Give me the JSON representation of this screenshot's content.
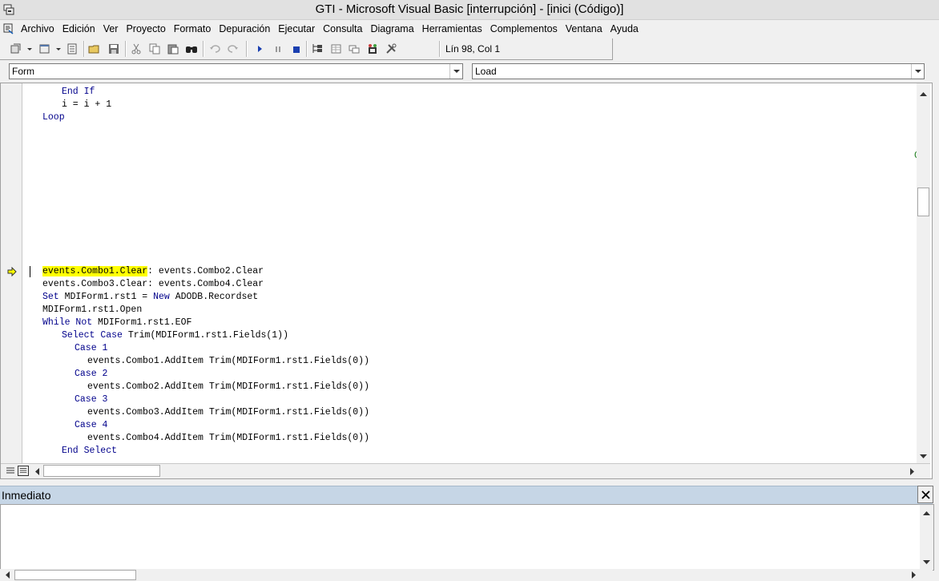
{
  "window": {
    "title": "GTI - Microsoft Visual Basic [interrupción] - [inici (Código)]"
  },
  "menubar": {
    "items": [
      "Archivo",
      "Edición",
      "Ver",
      "Proyecto",
      "Formato",
      "Depuración",
      "Ejecutar",
      "Consulta",
      "Diagrama",
      "Herramientas",
      "Complementos",
      "Ventana",
      "Ayuda"
    ]
  },
  "toolbar": {
    "status": "Lín 98, Col 1",
    "icons": [
      "add-project-icon",
      "add-form-icon",
      "menu-editor-icon",
      "open-icon",
      "save-icon",
      "cut-icon",
      "copy-icon",
      "paste-icon",
      "find-icon",
      "undo-icon",
      "redo-icon",
      "run-icon",
      "pause-icon",
      "stop-icon",
      "project-explorer-icon",
      "properties-icon",
      "form-layout-icon",
      "object-browser-icon",
      "toolbox-icon"
    ]
  },
  "combos": {
    "object": "Form",
    "procedure": "Load"
  },
  "code": {
    "lines_top": [
      "End If",
      "i = i + 1",
      "Loop"
    ],
    "current_line_highlight": "events.Combo1.Clear",
    "current_line_rest": ": events.Combo2.Clear",
    "lines_bottom": [
      "events.Combo3.Clear: events.Combo4.Clear",
      "Set MDIForm1.rst1 = New ADODB.Recordset",
      "MDIForm1.rst1.Open",
      "While Not MDIForm1.rst1.EOF",
      "Select Case Trim(MDIForm1.rst1.Fields(1))",
      "Case 1",
      "events.Combo1.AddItem Trim(MDIForm1.rst1.Fields(0))",
      "Case 2",
      "events.Combo2.AddItem Trim(MDIForm1.rst1.Fields(0))",
      "Case 3",
      "events.Combo3.AddItem Trim(MDIForm1.rst1.Fields(0))",
      "Case 4",
      "events.Combo4.AddItem Trim(MDIForm1.rst1.Fields(0))",
      "End Select"
    ],
    "stray_char": "C"
  },
  "immediate": {
    "title": "Inmediato",
    "content": ""
  },
  "colors": {
    "keyword": "#00008b",
    "highlight": "#ffff00",
    "titlebar": "#e1e1e1",
    "pane_title": "#c6d6e6"
  }
}
